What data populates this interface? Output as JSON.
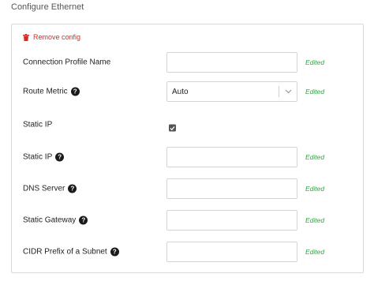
{
  "page_title": "Configure Ethernet",
  "remove_config": {
    "label": "Remove config",
    "icon": "trash-icon",
    "color": "#d62a2a"
  },
  "edited_color": "#35a24a",
  "fields": {
    "connection_profile_name": {
      "label": "Connection Profile Name",
      "value": "",
      "status": "Edited"
    },
    "route_metric": {
      "label": "Route Metric",
      "selected": "Auto",
      "status": "Edited"
    },
    "static_ip_toggle": {
      "label": "Static IP",
      "checked": true
    },
    "static_ip": {
      "label": "Static IP",
      "value": "",
      "status": "Edited"
    },
    "dns_server": {
      "label": "DNS Server",
      "value": "",
      "status": "Edited"
    },
    "static_gateway": {
      "label": "Static Gateway",
      "value": "",
      "status": "Edited"
    },
    "cidr_prefix": {
      "label": "CIDR Prefix of a Subnet",
      "value": "",
      "status": "Edited"
    }
  },
  "help_icon_glyph": "?"
}
